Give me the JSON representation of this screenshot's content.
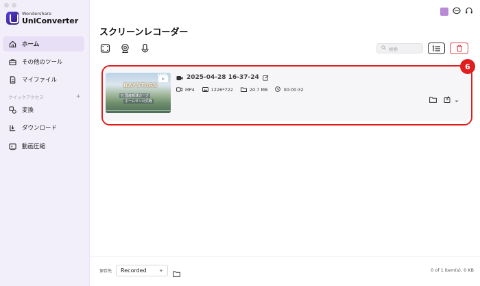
{
  "app": {
    "brand_small": "Wondershare",
    "brand_big": "UniConverter"
  },
  "sidebar": {
    "items": [
      {
        "label": "ホーム",
        "icon": "home-icon"
      },
      {
        "label": "その他のツール",
        "icon": "toolbox-icon"
      },
      {
        "label": "マイファイル",
        "icon": "file-icon"
      }
    ],
    "section_label": "クイックアクセス",
    "section_add": "+",
    "quick_items": [
      {
        "label": "変換",
        "icon": "convert-icon"
      },
      {
        "label": "ダウンロード",
        "icon": "download-icon"
      },
      {
        "label": "動画圧縮",
        "icon": "compress-icon"
      }
    ]
  },
  "main": {
    "title": "スクリーンレコーダー",
    "search_placeholder": "検索"
  },
  "recording": {
    "filename": "2025-04-28 16-37-24",
    "format": "MP4",
    "resolution": "1226*722",
    "size": "20.7 MB",
    "duration": "00:00:32",
    "thumb_logo": "BAYSTARS",
    "thumb_line1": "YJ 国産新球カーブ",
    "thumb_line2": "ホームラン公式戦"
  },
  "annotation": {
    "badge_number": "6",
    "color": "#e01e1e"
  },
  "footer": {
    "save_label": "保存先",
    "save_value": "Recorded",
    "summary": "0 of 1 item(s), 0 KB"
  },
  "colors": {
    "accent": "#5b3dd8",
    "sidebar_bg": "#f3effa",
    "danger": "#e04545"
  }
}
